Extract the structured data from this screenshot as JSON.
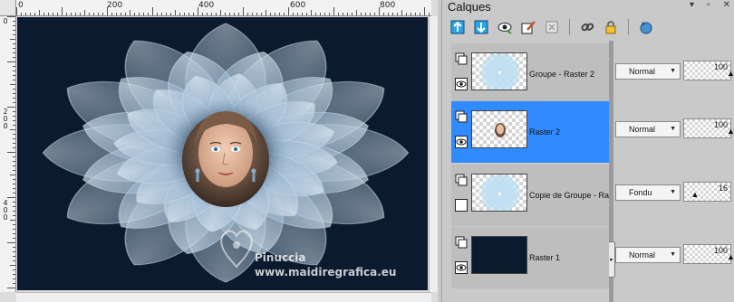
{
  "rulers": {
    "top_labels": [
      "0",
      "200",
      "400",
      "600",
      "800"
    ],
    "left_labels": [
      "0",
      "200",
      "400"
    ]
  },
  "watermark": {
    "line1": "Pinuccia",
    "line2": "www.maidiregrafica.eu"
  },
  "panel": {
    "title": "Calques",
    "controls": [
      "▾",
      "▫",
      "✕"
    ]
  },
  "toolbar": {
    "icons": [
      "new-raster-layer-icon",
      "new-vector-layer-icon",
      "visibility-toggle-icon",
      "layer-style-icon",
      "delete-layer-icon",
      "link-layers-icon",
      "lock-layer-icon",
      "refresh-icon"
    ]
  },
  "layers": [
    {
      "name": "Groupe - Raster 2",
      "blend": "Normal",
      "opacity": "100",
      "selected": false,
      "visible": true,
      "thumb": "flower"
    },
    {
      "name": "Raster 2",
      "blend": "Normal",
      "opacity": "100",
      "selected": true,
      "visible": true,
      "thumb": "portrait"
    },
    {
      "name": "Copie de Groupe - Ra",
      "blend": "Fondu",
      "opacity": "16",
      "selected": false,
      "visible": false,
      "thumb": "flower"
    },
    {
      "name": "Raster 1",
      "blend": "Normal",
      "opacity": "100",
      "selected": false,
      "visible": true,
      "thumb": "dark"
    }
  ],
  "colors": {
    "canvas_bg": "#0b1a2e",
    "selected_row": "#2f8bff",
    "flower": "#8fb0cc"
  }
}
